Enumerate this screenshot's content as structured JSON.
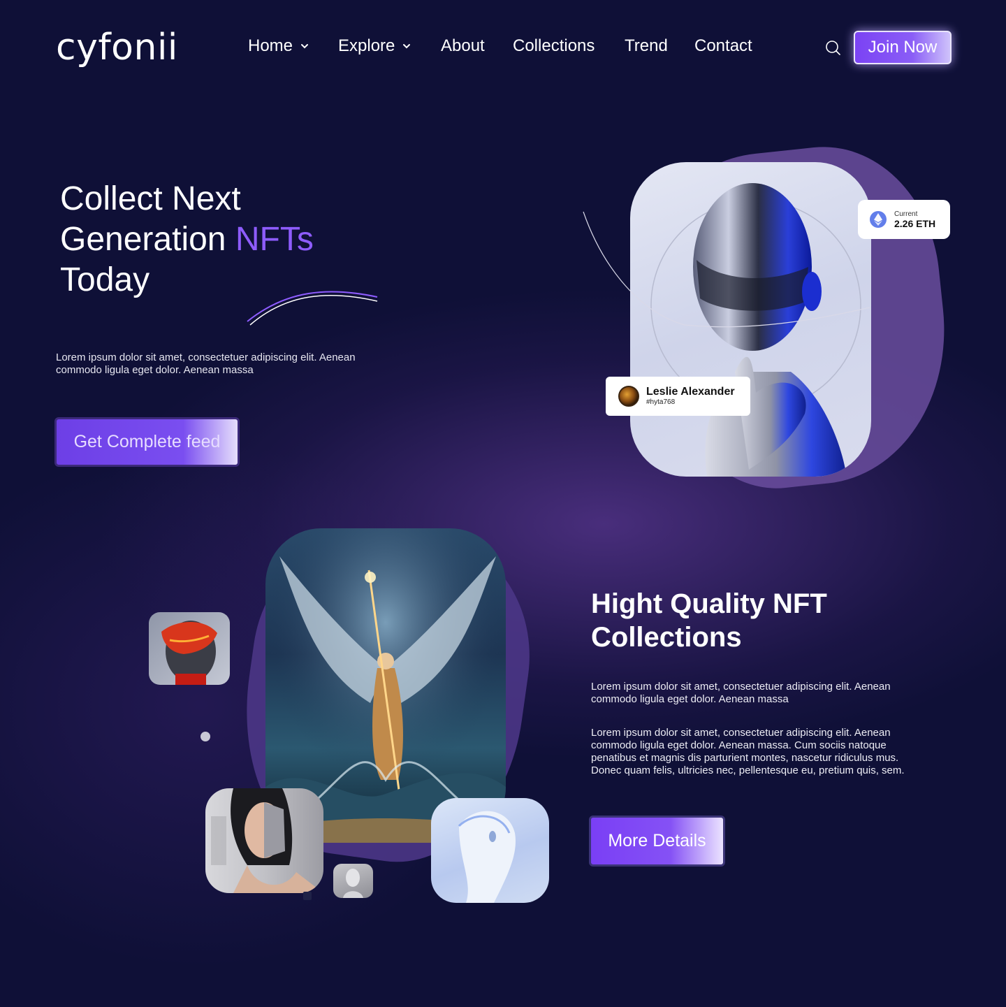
{
  "header": {
    "logo": "cyfonii",
    "nav": [
      {
        "label": "Home",
        "has_dropdown": true
      },
      {
        "label": "Explore",
        "has_dropdown": true
      },
      {
        "label": "About",
        "has_dropdown": false
      },
      {
        "label": "Collections",
        "has_dropdown": false
      },
      {
        "label": "Trend",
        "has_dropdown": false
      },
      {
        "label": "Contact",
        "has_dropdown": false
      }
    ],
    "search_icon": "search-icon",
    "join_label": "Join Now"
  },
  "hero": {
    "title_line1": "Collect Next",
    "title_line2_prefix": "Generation ",
    "title_line2_accent": "NFTs",
    "title_line3": "Today",
    "description": "Lorem ipsum dolor sit amet, consectetuer adipiscing elit. Aenean commodo ligula eget dolor. Aenean massa",
    "cta_label": "Get Complete feed",
    "price_chip": {
      "label": "Current",
      "value": "2.26 ETH",
      "icon": "ethereum-icon"
    },
    "creator_chip": {
      "name": "Leslie Alexander",
      "handle": "#hyta768"
    }
  },
  "collections": {
    "title": "Hight Quality NFT Collections",
    "paragraph1": "Lorem ipsum dolor sit amet, consectetuer adipiscing elit. Aenean commodo ligula eget dolor. Aenean massa",
    "paragraph2": "Lorem ipsum dolor sit amet, consectetuer adipiscing elit. Aenean commodo ligula eget dolor. Aenean massa. Cum sociis natoque penatibus et magnis dis parturient montes, nascetur ridiculus mus. Donec quam felis, ultricies nec, pellentesque eu, pretium quis, sem.",
    "button_label": "More Details"
  },
  "colors": {
    "background": "#0f1037",
    "accent": "#8e5cff",
    "button": "#7b43f4"
  }
}
